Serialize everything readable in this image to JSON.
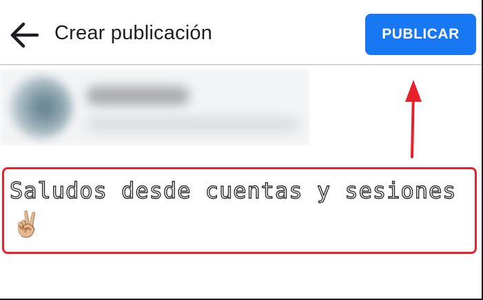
{
  "header": {
    "back_icon": "arrow-left-icon",
    "title": "Crear publicación",
    "publish_label": "PUBLICAR",
    "publish_color": "#1877f2"
  },
  "post": {
    "text": "Saludos desde cuentas y sesiones",
    "emoji": "✌🏼"
  },
  "annotation": {
    "color": "#e8202a",
    "arrow_icon": "red-arrow-up-icon"
  }
}
